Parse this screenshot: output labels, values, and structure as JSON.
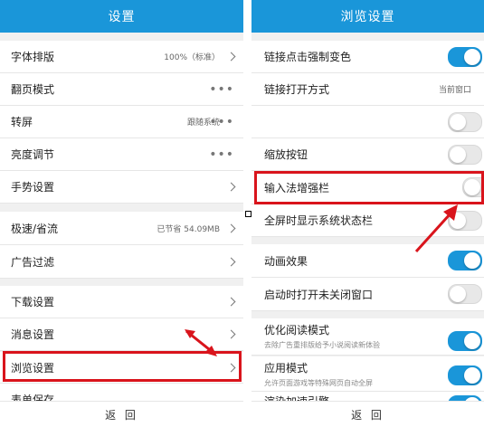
{
  "left": {
    "title": "设置",
    "rows": [
      {
        "label": "字体排版",
        "value": "100%（标准）"
      },
      {
        "label": "翻页模式"
      },
      {
        "label": "转屏",
        "value": "跟随系统"
      },
      {
        "label": "亮度调节"
      },
      {
        "label": "手势设置"
      },
      {
        "label": "极速/省流",
        "value": "已节省 54.09MB"
      },
      {
        "label": "广告过滤"
      },
      {
        "label": "下载设置"
      },
      {
        "label": "消息设置"
      },
      {
        "label": "浏览设置"
      },
      {
        "label": "表单保存"
      }
    ],
    "back_label": "返 回"
  },
  "right": {
    "title": "浏览设置",
    "rows": [
      {
        "label": "链接点击强制变色",
        "state": "on"
      },
      {
        "label": "链接打开方式",
        "value": "当前窗口"
      },
      {
        "label": "",
        "state": "off"
      },
      {
        "label": "缩放按钮",
        "state": "off"
      },
      {
        "label": "输入法增强栏",
        "state": "off"
      },
      {
        "label": "全屏时显示系统状态栏",
        "state": "off"
      },
      {
        "label": "动画效果",
        "state": "on"
      },
      {
        "label": "启动时打开未关闭窗口",
        "state": "off"
      },
      {
        "label": "优化阅读模式",
        "sub": "去除广告重排版给予小说阅读新体验",
        "state": "on"
      },
      {
        "label": "应用模式",
        "sub": "允许页面游戏等特殊网页自动全屏",
        "state": "on"
      },
      {
        "label": "渲染加速引擎",
        "state": "on"
      }
    ],
    "back_label": "返 回"
  },
  "colors": {
    "accent": "#1a96d9",
    "highlight": "#d9141c"
  },
  "icons": [
    "chevron-right-icon",
    "more-dots-icon",
    "toggle-switch-icon",
    "red-arrow-icon"
  ]
}
